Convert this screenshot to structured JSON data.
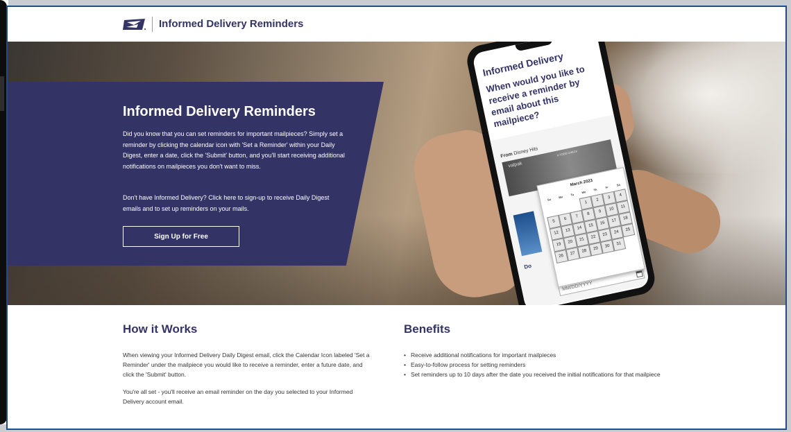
{
  "header": {
    "title": "Informed Delivery Reminders"
  },
  "hero": {
    "title": "Informed Delivery Reminders",
    "paragraph_1": "Did you know that you can set reminders for important mailpieces? Simply set a reminder by clicking the calendar icon with 'Set a Reminder' within your Daily Digest, enter a date, click the 'Submit' button, and you'll start receiving additional notifications on mailpieces you don't want to miss.",
    "paragraph_2": "Don't have Informed Delivery? Click here to sign-up to receive Daily Digest emails and to set up reminders on your mails.",
    "cta_label": "Sign Up for Free"
  },
  "phone": {
    "app_title": "Informed Delivery",
    "question": "When would you like to receive a reminder by email about this mailpiece?",
    "from_label": "From",
    "from_sender": "Disney Hits",
    "mail_brand": "valpak",
    "mail_tag": "A TODD CHECK",
    "do_label": "Do",
    "date_placeholder": "MM/DD/YYYY",
    "calendar": {
      "month": "March 2023",
      "weekdays": [
        "Su",
        "Mo",
        "Tu",
        "We",
        "Th",
        "Fr",
        "Sa"
      ],
      "leading_blanks": 3,
      "dates": [
        "1",
        "2",
        "3",
        "4",
        "5",
        "6",
        "7",
        "8",
        "9",
        "10",
        "11",
        "12",
        "13",
        "14",
        "15",
        "16",
        "17",
        "18",
        "19",
        "20",
        "21",
        "22",
        "23",
        "24",
        "25",
        "26",
        "27",
        "28",
        "29",
        "30",
        "31"
      ]
    }
  },
  "how_it_works": {
    "title": "How it Works",
    "paragraph_1": "When viewing your Informed Delivery Daily Digest email, click the Calendar Icon labeled 'Set a Reminder' under the mailpiece you would like to receive a reminder, enter a future date, and click the 'Submit' button.",
    "paragraph_2": "You're all set - you'll receive an email reminder on the day you selected to your Informed Delivery account email."
  },
  "benefits": {
    "title": "Benefits",
    "items": [
      "Receive additional notifications for important mailpieces",
      "Easy-to-follow process for setting reminders",
      "Set reminders up to 10 days after the date you received the initial notifications for that mailpiece"
    ]
  },
  "colors": {
    "brand_navy": "#333366",
    "frame_blue": "#1f4d8c"
  }
}
